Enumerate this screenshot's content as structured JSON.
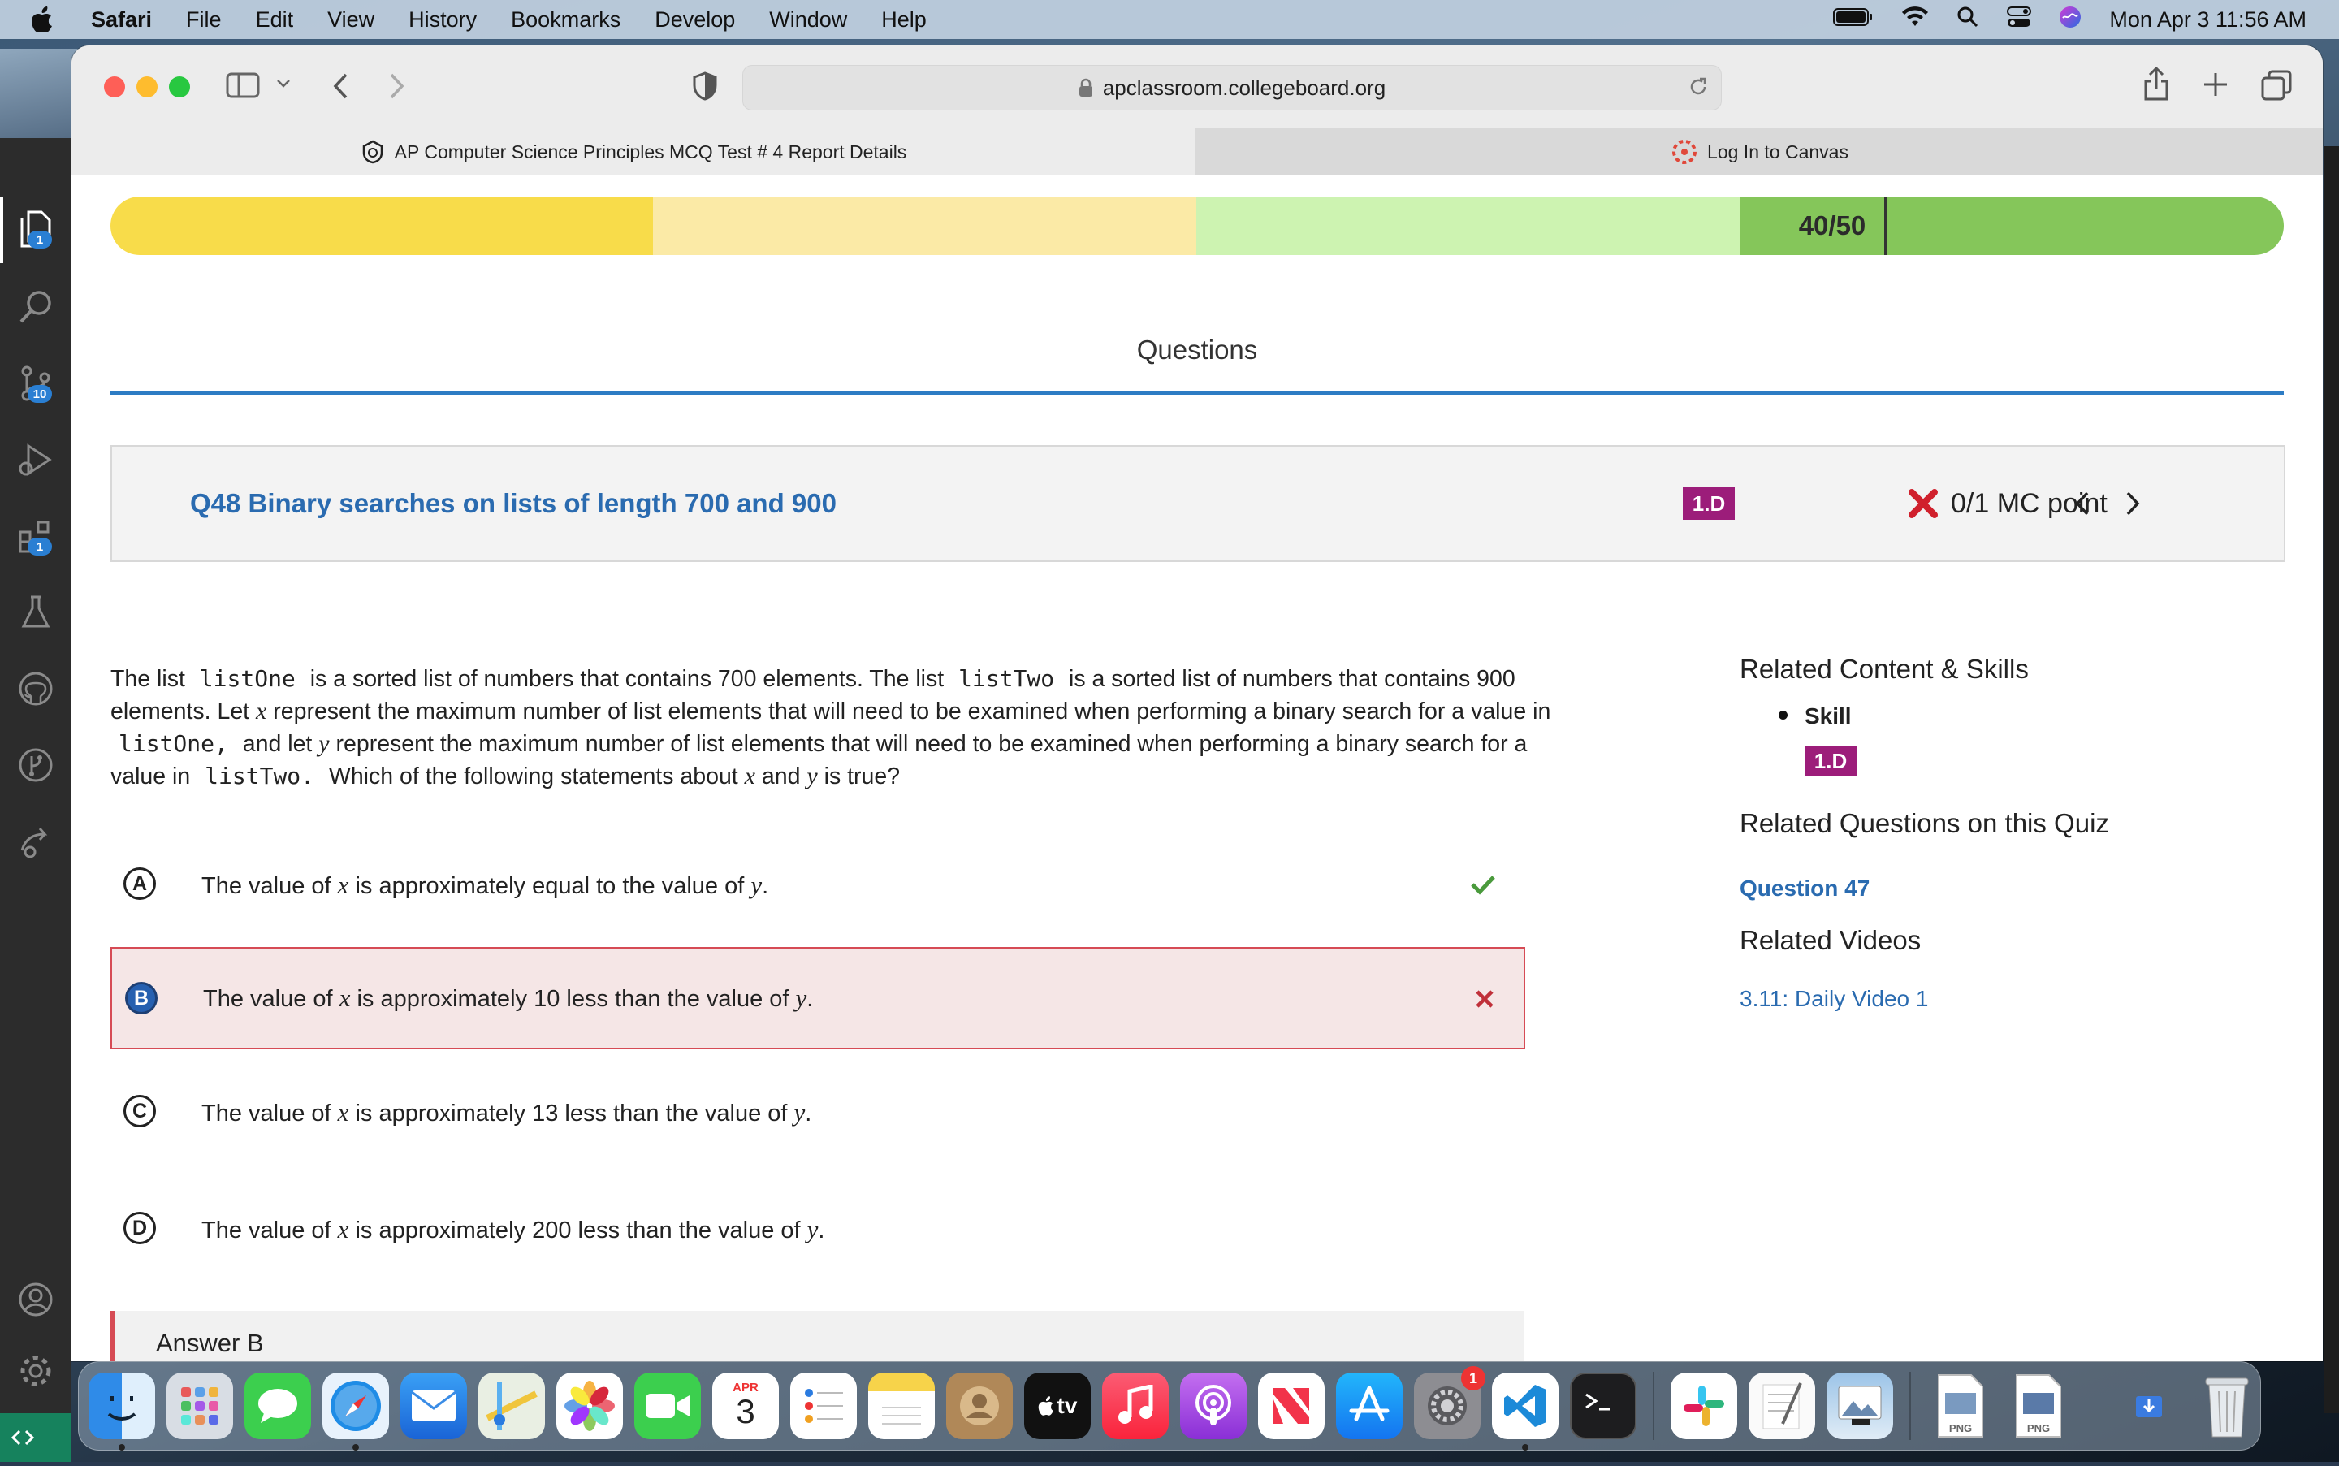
{
  "menubar": {
    "app_name": "Safari",
    "items": [
      "File",
      "Edit",
      "View",
      "History",
      "Bookmarks",
      "Develop",
      "Window",
      "Help"
    ],
    "clock": "Mon Apr 3  11:56 AM"
  },
  "browser": {
    "url": "apclassroom.collegeboard.org",
    "tabs": [
      {
        "title": "AP Computer Science Principles MCQ Test # 4 Report Details",
        "active": true
      },
      {
        "title": "Log In to Canvas",
        "active": false
      }
    ]
  },
  "vscode": {
    "badges": {
      "explorer": "1",
      "source_control": "10",
      "extensions": "1"
    }
  },
  "score": {
    "label": "40/50",
    "fraction": 0.8,
    "colors": {
      "seg1": "#f8dc4a",
      "seg2": "#fbeaa6",
      "seg3": "#cdf3b1",
      "seg4": "#85c65a"
    }
  },
  "section_heading": "Questions",
  "question": {
    "title": "Q48 Binary searches on lists of length 700 and 900",
    "skill_code": "1.D",
    "points": "0/1 MC point",
    "stem": {
      "p1": "The list ",
      "code1": "listOne",
      "p2": " is a sorted list of numbers that contains 700 elements. The list ",
      "code2": "listTwo",
      "p3": " is a sorted list of numbers that contains 900 elements. Let ",
      "var_x": "x",
      "p4": " represent the maximum number of list elements that will need to be examined when performing a binary search for a value in ",
      "code3": "listOne,",
      "p5": " and let ",
      "var_y": "y",
      "p6": " represent the maximum number of list elements that will need to be examined when performing a binary search for a value in ",
      "code4": "listTwo.",
      "p7": " Which of the following statements about ",
      "var_x2": "x",
      "p8": " and ",
      "var_y2": "y",
      "p9": " is true?"
    },
    "choices": [
      {
        "letter": "A",
        "pre": "The value of ",
        "x": "x",
        "mid": " is approximately equal to the value of ",
        "y": "y",
        "end": ".",
        "status": "correct"
      },
      {
        "letter": "B",
        "pre": "The value of ",
        "x": "x",
        "mid": " is approximately 10 less than the value of ",
        "y": "y",
        "end": ".",
        "status": "selected-wrong"
      },
      {
        "letter": "C",
        "pre": "The value of ",
        "x": "x",
        "mid": " is approximately 13 less than the value of ",
        "y": "y",
        "end": ".",
        "status": "none"
      },
      {
        "letter": "D",
        "pre": "The value of ",
        "x": "x",
        "mid": " is approximately 200 less than the value of ",
        "y": "y",
        "end": ".",
        "status": "none"
      }
    ],
    "answer_label": "Answer B"
  },
  "sidebar": {
    "related_content_heading": "Related Content & Skills",
    "skill_label": "Skill",
    "skill_code": "1.D",
    "related_questions_heading": "Related Questions on this Quiz",
    "related_question_link": "Question 47",
    "related_videos_heading": "Related Videos",
    "related_video_link": "3.11: Daily Video 1"
  },
  "dock": {
    "calendar_month": "APR",
    "calendar_day": "3",
    "tv_label": "tv",
    "settings_badge": "1",
    "png_label": "PNG"
  },
  "accent_colors": {
    "link_blue": "#2a6bb0",
    "skill_purple": "#9c1d7a",
    "wrong_red": "#d64b55",
    "correct_green": "#4a9a3c"
  }
}
